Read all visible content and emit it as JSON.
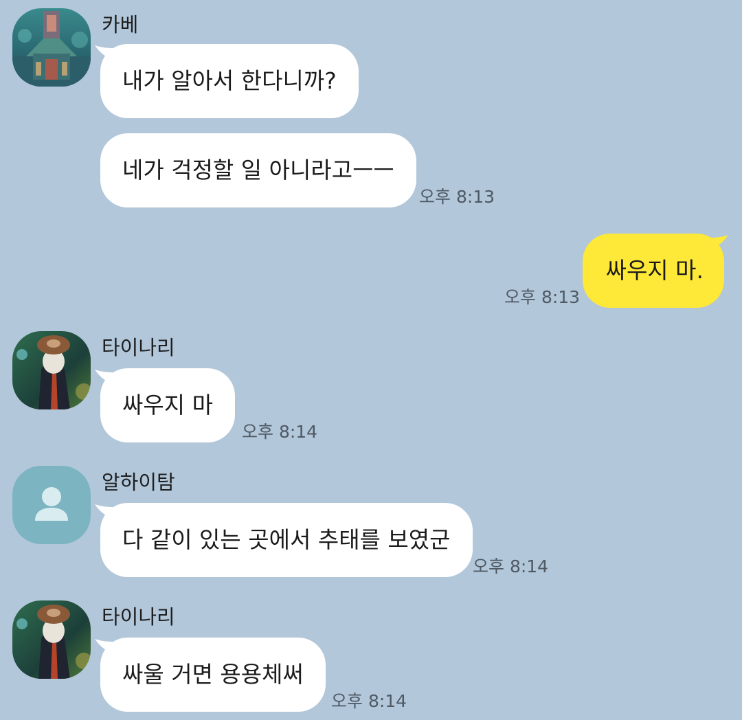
{
  "colors": {
    "background": "#b2c7da",
    "incoming_bubble": "#ffffff",
    "outgoing_bubble": "#fee838",
    "time_text": "#4f5964"
  },
  "messages": [
    {
      "sender": "카베",
      "avatar": "kaveh-avatar-image",
      "texts": [
        "내가 알아서 한다니까?",
        "네가 걱정할 일 아니라고ㅡㅡ"
      ],
      "time": "오후 8:13"
    },
    {
      "outgoing": true,
      "text": "싸우지 마.",
      "time": "오후 8:13"
    },
    {
      "sender": "타이나리",
      "avatar": "tighnari-avatar-image",
      "text": "싸우지 마",
      "time": "오후 8:14"
    },
    {
      "sender": "알하이탐",
      "avatar": "default-person-icon",
      "text": "다 같이 있는 곳에서 추태를 보였군",
      "time": "오후 8:14"
    },
    {
      "sender": "타이나리",
      "avatar": "tighnari-avatar-image",
      "text": "싸울 거면 용용체써",
      "time": "오후 8:14"
    }
  ]
}
